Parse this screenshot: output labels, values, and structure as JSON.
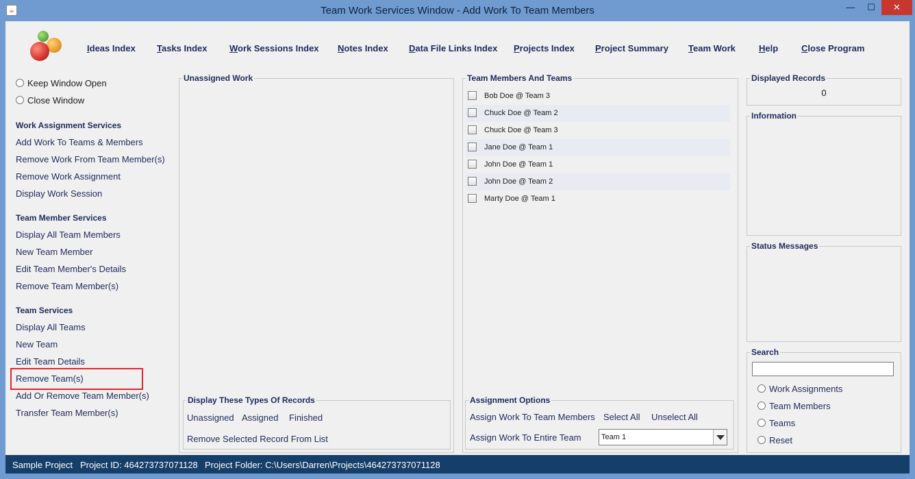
{
  "window": {
    "title": "Team Work Services Window - Add Work To Team Members",
    "min_glyph": "—",
    "max_glyph": "☐",
    "close_glyph": "✕",
    "app_icon_glyph": "☕"
  },
  "top_menu": [
    {
      "label": "Ideas Index"
    },
    {
      "label": "Tasks Index"
    },
    {
      "label": "Work Sessions Index"
    },
    {
      "label": "Notes Index"
    },
    {
      "label": "Data File Links Index"
    },
    {
      "label": "Projects Index"
    },
    {
      "label": "Project Summary"
    },
    {
      "label": "Team Work"
    },
    {
      "label": "Help"
    },
    {
      "label": "Close Program"
    }
  ],
  "left_panel": {
    "keep_window_open": "Keep Window Open",
    "close_window": "Close Window",
    "work_assignment": {
      "heading": "Work Assignment Services",
      "items": [
        "Add Work To Teams & Members",
        "Remove Work From Team Member(s)",
        "Remove Work Assignment",
        "Display Work Session"
      ]
    },
    "team_member": {
      "heading": "Team Member Services",
      "items": [
        "Display All Team Members",
        "New Team Member",
        "Edit Team Member's Details",
        "Remove Team Member(s)"
      ]
    },
    "team": {
      "heading": "Team Services",
      "items": [
        "Display All Teams",
        "New Team",
        "Edit Team Details",
        "Remove Team(s)",
        "Add Or Remove Team Member(s)",
        "Transfer Team Member(s)"
      ]
    }
  },
  "unassigned_work": {
    "title": "Unassigned Work",
    "display_types": {
      "title": "Display These Types Of Records",
      "unassigned": "Unassigned",
      "assigned": "Assigned",
      "finished": "Finished",
      "remove_selected": "Remove Selected Record From List"
    }
  },
  "team_members": {
    "title": "Team Members And Teams",
    "members": [
      "Bob Doe @ Team 3",
      "Chuck Doe @ Team 2",
      "Chuck Doe @ Team 3",
      "Jane Doe @ Team 1",
      "John Doe @ Team 1",
      "John Doe @ Team 2",
      "Marty Doe @ Team 1"
    ],
    "assignment_options": {
      "title": "Assignment Options",
      "assign_members": "Assign Work To Team Members",
      "select_all": "Select All",
      "unselect_all": "Unselect All",
      "assign_team": "Assign Work To Entire Team",
      "team_selected": "Team 1"
    }
  },
  "right_panel": {
    "displayed_records_title": "Displayed Records",
    "displayed_records_value": "0",
    "information_title": "Information",
    "status_title": "Status Messages",
    "search": {
      "title": "Search",
      "value": "",
      "options": [
        "Work Assignments",
        "Team Members",
        "Teams",
        "Reset"
      ]
    }
  },
  "status_bar": {
    "project": "Sample Project",
    "project_id": "Project ID:  464273737071128",
    "project_folder": "Project Folder:  C:\\Users\\Darren\\Projects\\464273737071128"
  },
  "colors": {
    "accent_text": "#1f2a5c",
    "status_bar": "#153f69",
    "highlight": "#e0262c",
    "window_frame": "#6f9bd0"
  }
}
